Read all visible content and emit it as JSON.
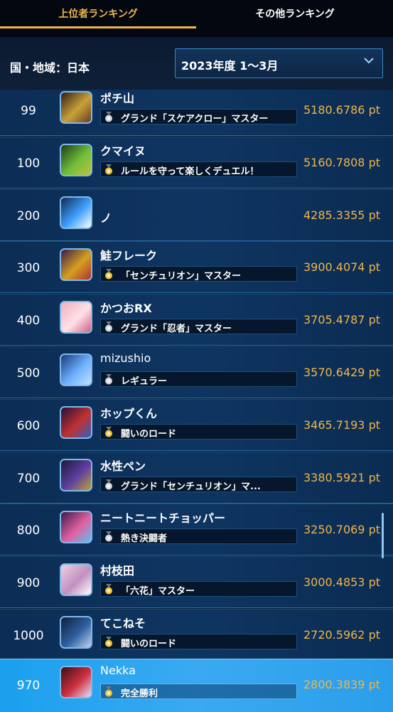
{
  "tabs": [
    {
      "label": "上位者ランキング",
      "active": true
    },
    {
      "label": "その他ランキング",
      "active": false
    }
  ],
  "filter": {
    "region_label": "国・地域：日本",
    "period_selected": "2023年度 1〜3月"
  },
  "rows": [
    {
      "rank": "99",
      "name": "ポチ山",
      "title": "グランド「スケアクロー」マスター",
      "medal": "silver",
      "points": "5180.6786 pt",
      "avatar_colors": [
        "#2b1f1a",
        "#c9a13a",
        "#6b3c1f"
      ]
    },
    {
      "rank": "100",
      "name": "クマイヌ",
      "title": "ルールを守って楽しくデュエル！",
      "medal": "gold",
      "points": "5160.7808 pt",
      "avatar_colors": [
        "#1f3a1a",
        "#6fbf3a",
        "#c0c040"
      ]
    },
    {
      "rank": "200",
      "name": "ノ",
      "title": "",
      "medal": "",
      "points": "4285.3355 pt",
      "avatar_colors": [
        "#0f2a55",
        "#3fa0ff",
        "#ffffff"
      ]
    },
    {
      "rank": "300",
      "name": "鮭フレーク",
      "title": "「センチュリオン」マスター",
      "medal": "gold",
      "points": "3900.4074 pt",
      "avatar_colors": [
        "#3a1a4a",
        "#d4a020",
        "#b03030"
      ]
    },
    {
      "rank": "400",
      "name": "かつおRX",
      "title": "グランド「忍者」マスター",
      "medal": "silver",
      "points": "3705.4787 pt",
      "avatar_colors": [
        "#f0b0c0",
        "#ffe0e8",
        "#d06080"
      ]
    },
    {
      "rank": "500",
      "name": "mizushio",
      "title": "レギュラー",
      "medal": "silver",
      "points": "3570.6429 pt",
      "avatar_colors": [
        "#1a3a7a",
        "#6fb0ff",
        "#c0e0ff"
      ]
    },
    {
      "rank": "600",
      "name": "ホップくん",
      "title": "闘いのロード",
      "medal": "gold",
      "points": "3465.7193 pt",
      "avatar_colors": [
        "#2a0f3a",
        "#c03030",
        "#3060c0"
      ]
    },
    {
      "rank": "700",
      "name": "水性ペン",
      "title": "グランド「センチュリオン」マ...",
      "medal": "silver",
      "points": "3380.5921 pt",
      "avatar_colors": [
        "#1a1a3a",
        "#6040a0",
        "#c0a030"
      ]
    },
    {
      "rank": "800",
      "name": "ニートニートチョッパー",
      "title": "熱き決闘者",
      "medal": "silver",
      "points": "3250.7069 pt",
      "avatar_colors": [
        "#3a1a4a",
        "#e060a0",
        "#60c0f0"
      ]
    },
    {
      "rank": "900",
      "name": "村枝田",
      "title": "「六花」マスター",
      "medal": "gold",
      "points": "3000.4853 pt",
      "avatar_colors": [
        "#f0d0e0",
        "#c090c0",
        "#ffffff"
      ]
    },
    {
      "rank": "1000",
      "name": "てこねそ",
      "title": "闘いのロード",
      "medal": "gold",
      "points": "2720.5962 pt",
      "avatar_colors": [
        "#0f1f3a",
        "#3060a0",
        "#c0d0f0"
      ]
    }
  ],
  "me": {
    "rank": "970",
    "name": "Nekka",
    "title": "完全勝利",
    "medal": "gold",
    "points": "2800.3839 pt",
    "avatar_colors": [
      "#3a0f1a",
      "#d03040",
      "#e0e0ff"
    ]
  },
  "colors": {
    "accent": "#f0b54a",
    "highlight_row": "#2aa6f0",
    "gold_medal": "#f2c230",
    "silver_medal": "#cfd6de"
  }
}
